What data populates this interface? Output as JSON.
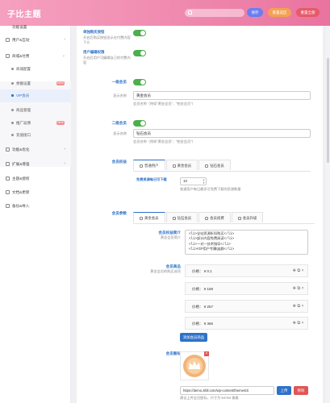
{
  "header": {
    "brand": "子比主题",
    "search_placeholder": "",
    "buttons": [
      {
        "label": "保存",
        "color": "#6a7ef0"
      },
      {
        "label": "重置选区",
        "color": "#f3a253"
      },
      {
        "label": "重置全部",
        "color": "#e65a6a"
      }
    ]
  },
  "sidebar": {
    "top_cut": "功能设置",
    "items": [
      {
        "label": "用户&互动"
      },
      {
        "label": "商城&付费"
      },
      {
        "label": "功能&优化"
      },
      {
        "label": "扩展&增强"
      },
      {
        "label": "主题&授权"
      },
      {
        "label": "文档&更新"
      },
      {
        "label": "备份&导入"
      }
    ],
    "subs": [
      {
        "label": "商城配置",
        "badge": ""
      },
      {
        "label": "余额设置",
        "badge": "NEW"
      },
      {
        "label": "VIP会员",
        "badge": ""
      },
      {
        "label": "商品管理",
        "badge": ""
      },
      {
        "label": "推广返佣",
        "badge": "NEW"
      },
      {
        "label": "充值接口",
        "badge": ""
      }
    ]
  },
  "content": {
    "opt1": {
      "label": "单独购买按钮",
      "desc": "开启后购买按钮显示在付费内容下方"
    },
    "opt2": {
      "label": "用户编辑权限",
      "desc": "开启后用户可编辑自己的付费内容"
    },
    "vip1": {
      "label": "一级会员",
      "name_label": "显示名称",
      "name_value": "黄金会员",
      "hint": "会员名称（例如“黄金会员”、“铂金会员”）"
    },
    "vip2": {
      "label": "二级会员",
      "name_label": "显示名称",
      "name_value": "钻石会员",
      "hint": "会员名称（例如“黄金会员”、“铂金会员”）"
    },
    "pricing": {
      "label": "会员权益",
      "tabs": [
        "普通用户",
        "黄金会员",
        "钻石会员"
      ],
      "free_label": "免费资源每日可下载",
      "free_value": "10",
      "free_hint": "普通用户每日最多可免费下载的资源数量"
    },
    "params": {
      "label": "会员参数",
      "tabs": [
        "黄金会员",
        "钻石会员",
        "会员续费",
        "会员升级"
      ],
      "desc_label": "会员权益简介",
      "desc_sub": "黄金会员简介",
      "desc_lines": [
        "<li>全站资源折扣购买</li>",
        "<li>部分内容免费阅读</li>",
        "<li>一对一技术指导</li>",
        "<li>VIP用户专属QQ群</li>"
      ],
      "product_label": "会员商品",
      "product_sub": "黄金会员的购买选项",
      "products": [
        {
          "text": "价格： ¥ 0.1"
        },
        {
          "text": "价格： ¥ 168"
        },
        {
          "text": "价格： ¥ 257"
        },
        {
          "text": "价格： ¥ 366"
        }
      ],
      "add_button": "添加会员商品",
      "icon_label": "会员图标",
      "icon_url": "https://demo.zibll.com/wp-content/themes/zi",
      "upload": "上传",
      "remove": "移除",
      "icon_hint": "建议上传会员图标，尺寸为 64×64 像素"
    }
  },
  "colors": {
    "header_start": "#f6a0c0",
    "header_end": "#e9739f",
    "accent": "#2f72c9",
    "toggle": "#4cae4c"
  }
}
